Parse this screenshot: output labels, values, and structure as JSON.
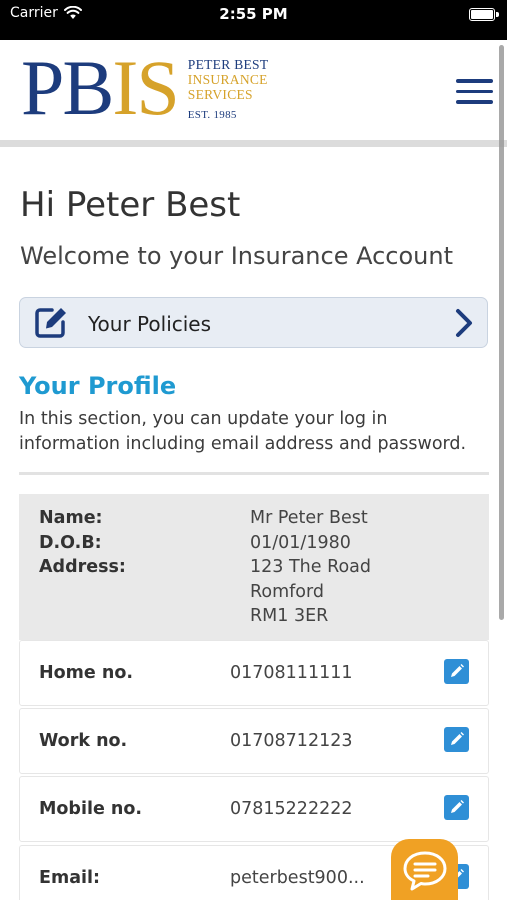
{
  "status_bar": {
    "carrier": "Carrier",
    "time": "2:55 PM",
    "icons": [
      "wifi-icon",
      "battery-icon"
    ]
  },
  "header": {
    "logo": {
      "letters_blue": "PB",
      "letters_gold": "IS",
      "line1": "PETER BEST",
      "line2": "INSURANCE",
      "line3": "SERVICES",
      "established": "EST. 1985"
    },
    "menu_icon": "hamburger-menu-icon"
  },
  "greeting": "Hi Peter Best",
  "welcome": "Welcome to your Insurance Account",
  "policies": {
    "label": "Your Policies",
    "icon": "edit-square-icon",
    "chevron": "chevron-right-icon"
  },
  "profile": {
    "title": "Your Profile",
    "description": "In this section, you can update your log in information including email address and password.",
    "info": {
      "name_label": "Name:",
      "name_value": "Mr Peter Best",
      "dob_label": "D.O.B:",
      "dob_value": "01/01/1980",
      "address_label": "Address:",
      "address_lines": [
        "123 The Road",
        "Romford",
        "RM1 3ER"
      ]
    },
    "contacts": [
      {
        "label": "Home no.",
        "value": "01708111111"
      },
      {
        "label": "Work no.",
        "value": "01708712123"
      },
      {
        "label": "Mobile no.",
        "value": "07815222222"
      },
      {
        "label": "Email:",
        "value": "peterbest900..."
      }
    ]
  },
  "chat": {
    "icon": "chat-bubble-icon"
  },
  "colors": {
    "brand_blue": "#1d3c7d",
    "brand_gold": "#d6a22a",
    "accent": "#1f9ad1",
    "edit_button": "#2f8fd6",
    "chat": "#f0a124"
  }
}
